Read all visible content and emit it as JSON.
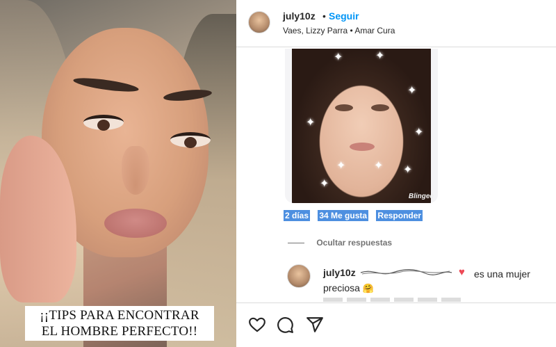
{
  "video": {
    "caption_line1": "¡¡TIPS PARA ENCONTRAR",
    "caption_line2": "EL HOMBRE PERFECTO!!"
  },
  "header": {
    "username": "july10z",
    "separator": "•",
    "follow_label": "Seguir",
    "music": "Vaes, Lizzy Parra • Amar Cura"
  },
  "comment": {
    "image_watermark": "Blingee",
    "time": "2 días",
    "likes": "34 Me gusta",
    "reply_label": "Responder"
  },
  "replies": {
    "toggle_label": "Ocultar respuestas",
    "items": [
      {
        "username": "july10z",
        "text_after_heart": "es una mujer",
        "text_line2": "preciosa",
        "heart_icon": "heart-emoji",
        "hug_icon": "hugging-face-emoji"
      }
    ]
  },
  "actions": {
    "icons": [
      "heart-icon",
      "comment-icon",
      "share-icon"
    ]
  },
  "colors": {
    "link_blue": "#0095f6",
    "selection_blue": "#4d8fe0",
    "heart_red": "#ed4956"
  }
}
